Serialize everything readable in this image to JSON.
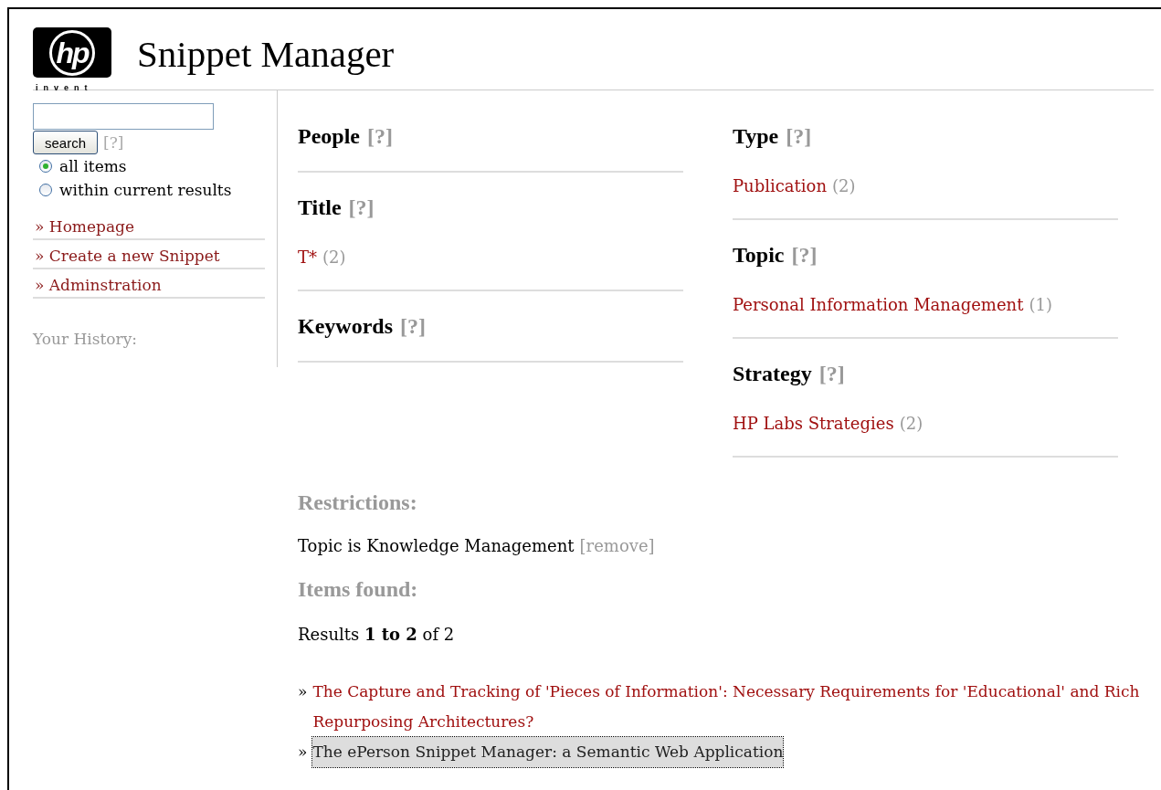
{
  "header": {
    "logo_text": "hp",
    "logo_tagline": "invent",
    "title": "Snippet Manager"
  },
  "sidebar": {
    "search": {
      "button": "search",
      "help": "[?]"
    },
    "scope": [
      {
        "label": "all items",
        "selected": true
      },
      {
        "label": "within current results",
        "selected": false
      }
    ],
    "links": [
      "» Homepage",
      "» Create a new Snippet",
      "» Adminstration"
    ],
    "history_label": "Your History:"
  },
  "facet_columns": [
    [
      {
        "title": "People",
        "help": "[?]"
      },
      {
        "title": "Title",
        "help": "[?]",
        "values": [
          {
            "label": "T*",
            "count": "(2)"
          }
        ]
      },
      {
        "title": "Keywords",
        "help": "[?]"
      }
    ],
    [
      {
        "title": "Type",
        "help": "[?]",
        "values": [
          {
            "label": "Publication",
            "count": "(2)"
          }
        ]
      },
      {
        "title": "Topic",
        "help": "[?]",
        "values": [
          {
            "label": "Personal Information Management",
            "count": "(1)"
          }
        ]
      },
      {
        "title": "Strategy",
        "help": "[?]",
        "values": [
          {
            "label": "HP Labs Strategies",
            "count": "(2)"
          }
        ]
      }
    ]
  ],
  "restrictions": {
    "heading": "Restrictions:",
    "items": [
      {
        "text": "Topic is Knowledge Management",
        "action": "[remove]"
      }
    ]
  },
  "results": {
    "heading": "Items found:",
    "summary": "Results **1 to 2** of 2",
    "items": [
      {
        "bullet": "»",
        "title": "The Capture and Tracking of 'Pieces of Information': Necessary Requirements for 'Educational' and Rich Repurposing Architectures?",
        "selected": false
      },
      {
        "bullet": "»",
        "title": "The ePerson Snippet Manager: a Semantic Web Application",
        "selected": true
      }
    ]
  }
}
